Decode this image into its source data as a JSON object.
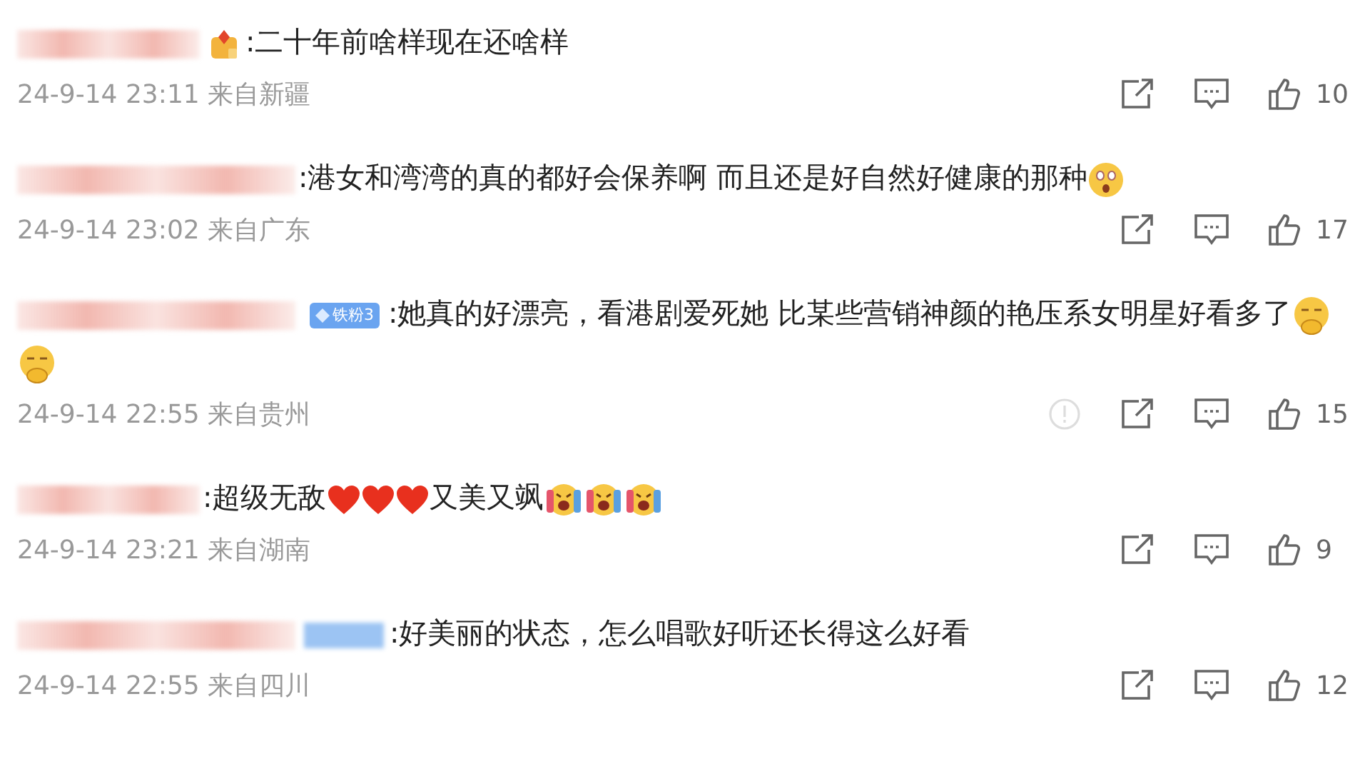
{
  "comments": [
    {
      "badge": {
        "kind": "medal"
      },
      "body": [
        {
          "kind": "text",
          "text": ":二十年前啥样现在还啥样"
        }
      ],
      "time": "24-9-14 23:11",
      "location": "来自新疆",
      "show_report": false,
      "likes": "10"
    },
    {
      "badge": {
        "kind": "none"
      },
      "body": [
        {
          "kind": "text",
          "text": ":港女和湾湾的真的都好会保养啊  而且还是好自然好健康的那种"
        },
        {
          "kind": "shock"
        }
      ],
      "time": "24-9-14 23:02",
      "location": "来自广东",
      "show_report": false,
      "likes": "17"
    },
    {
      "badge": {
        "kind": "fan",
        "text": "铁粉3"
      },
      "body": [
        {
          "kind": "text",
          "text": ":她真的好漂亮，看港剧爱死她 比某些营销神颜的艳压系女明星好看多了"
        },
        {
          "kind": "shy"
        },
        {
          "kind": "shy"
        }
      ],
      "time": "24-9-14 22:55",
      "location": "来自贵州",
      "show_report": true,
      "likes": "15"
    },
    {
      "badge": {
        "kind": "none"
      },
      "body": [
        {
          "kind": "text",
          "text": ":超级无敌"
        },
        {
          "kind": "heart"
        },
        {
          "kind": "heart"
        },
        {
          "kind": "heart"
        },
        {
          "kind": "text",
          "text": "又美又飒"
        },
        {
          "kind": "cry"
        },
        {
          "kind": "cry"
        },
        {
          "kind": "cry"
        }
      ],
      "time": "24-9-14 23:21",
      "location": "来自湖南",
      "show_report": false,
      "likes": "9"
    },
    {
      "badge": {
        "kind": "blurred"
      },
      "body": [
        {
          "kind": "text",
          "text": ":好美丽的状态，怎么唱歌好听还长得这么好看"
        }
      ],
      "time": "24-9-14 22:55",
      "location": "来自四川",
      "show_report": false,
      "likes": "12"
    }
  ]
}
